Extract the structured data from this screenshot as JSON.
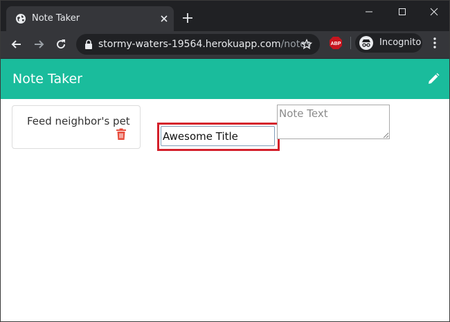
{
  "browser": {
    "tab_title": "Note Taker",
    "url_host": "stormy-waters-19564.herokuapp.com",
    "url_path": "/notes",
    "incognito_label": "Incognito",
    "extension_badge": "ABP",
    "icons": [
      "globe-icon",
      "close-icon",
      "plus-icon",
      "minimize-icon",
      "maximize-icon",
      "window-close-icon",
      "back-icon",
      "forward-icon",
      "reload-icon",
      "lock-icon",
      "star-icon",
      "incognito-icon",
      "kebab-menu-icon"
    ]
  },
  "app": {
    "title": "Note Taker",
    "accent_color": "#1abc9c",
    "new_note_icon": "pencil-icon"
  },
  "notes": [
    {
      "title": "Feed neighbor's pet",
      "delete_icon": "trash-icon",
      "delete_color": "#e74c3c"
    }
  ],
  "editor": {
    "title_value": "Awesome Title",
    "text_placeholder": "Note Text",
    "highlight_color": "#d4202b"
  }
}
